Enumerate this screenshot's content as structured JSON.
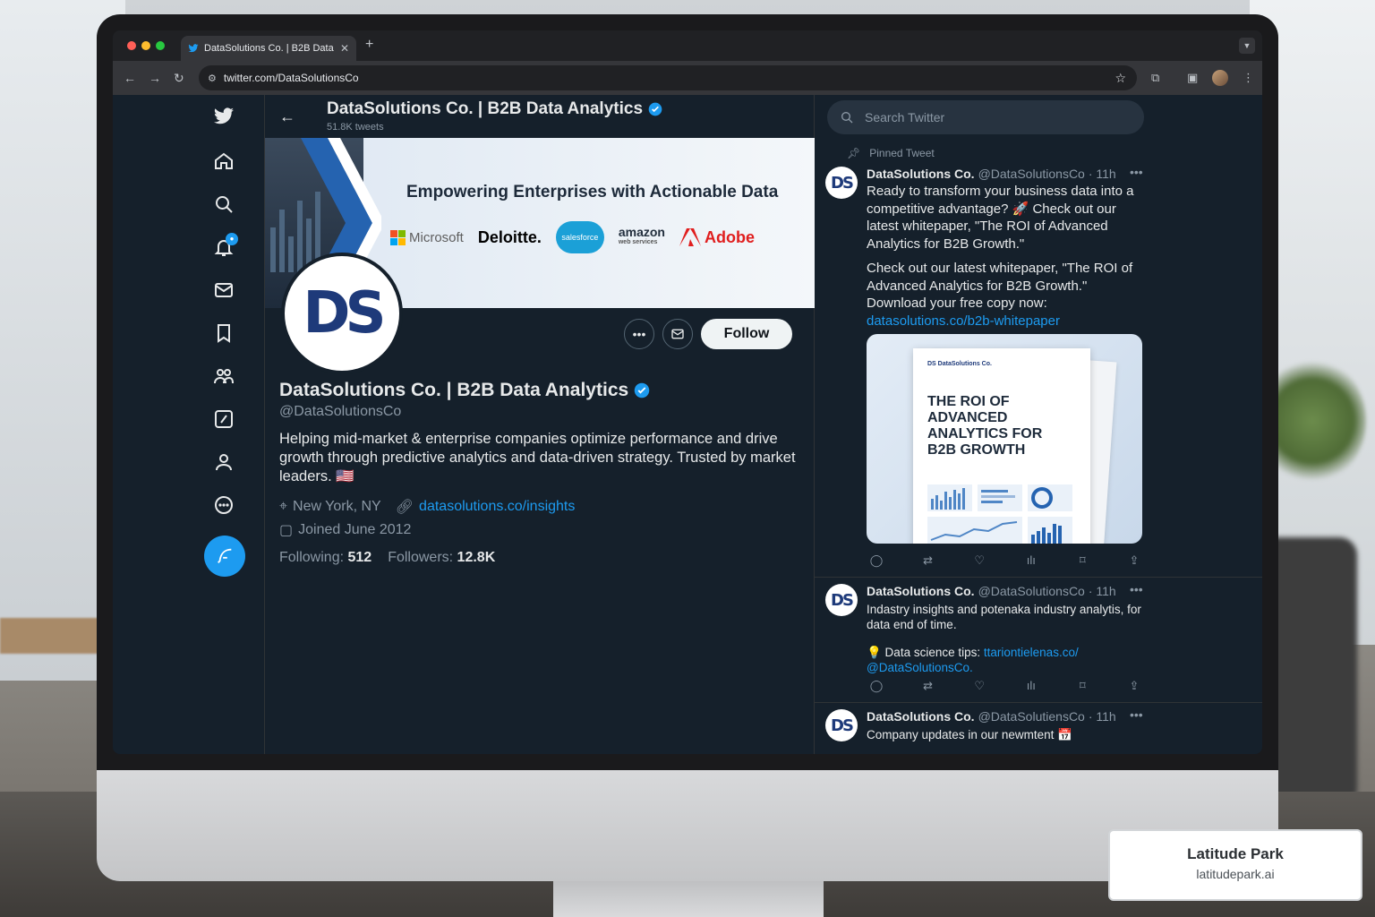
{
  "browser": {
    "tab_title": "DataSolutions Co. | B2B Data",
    "url": "twitter.com/DataSolutionsCo"
  },
  "profile": {
    "header_name": "DataSolutions Co. | B2B Data Analytics",
    "tweet_count": "51.8K tweets",
    "banner_title": "Empowering Enterprises with Actionable Data",
    "banner_logos": [
      "Microsoft",
      "Deloitte.",
      "salesforce",
      "amazon",
      "Adobe"
    ],
    "aws_sub": "web services",
    "avatar_text": "DS",
    "follow_label": "Follow",
    "name": "DataSolutions Co. | B2B Data Analytics",
    "handle": "@DataSolutionsCo",
    "bio": "Helping mid-market & enterprise companies optimize performance and drive growth through predictive analytics and data-driven strategy. Trusted by market leaders. 🇺🇸",
    "location": "New York, NY",
    "website": "datasolutions.co/insights",
    "joined": "Joined June 2012",
    "following_label": "Following:",
    "following_count": "512",
    "followers_label": "Followers:",
    "followers_count": "12.8K"
  },
  "search": {
    "placeholder": "Search Twitter"
  },
  "tweets": [
    {
      "pinned_label": "Pinned Tweet",
      "name": "DataSolutions Co.",
      "handle": "@DataSolutionsCo",
      "time": "· 11h",
      "text_1": "Ready to transform your business data into a competitive advantage? 🚀 Check out our latest whitepaper, \"The ROI of Advanced Analytics for B2B Growth.\"",
      "text_2": "Check out our latest whitepaper, \"The ROI of Advanced Analytics for B2B Growth.\" Download your free copy now:",
      "link": "datasolutions.co/b2b-whitepaper",
      "media_logo": "DS DataSolutions Co.",
      "media_title": "THE ROI OF\nADVANCED\nANALYTICS FOR\nB2B GROWTH"
    },
    {
      "name": "DataSolutions Co.",
      "handle": "@DataSolutionsCo",
      "time": "· 11h",
      "text_1": "Indastry insights and potenaka industry analytis, for data end of time.",
      "tip_label": "💡 Data science tips:",
      "tip_link": "ttariontielenas.co/",
      "tip_handle": "@DataSolutionsCo."
    },
    {
      "name": "DataSolutions Co.",
      "handle": "@DataSolutiensCo",
      "time": "· 11h",
      "text_1": "Company updates in our newmtent 📅"
    }
  ],
  "watermark": {
    "title": "Latitude Park",
    "subtitle": "latitudepark.ai"
  },
  "colors": {
    "twitter_blue": "#1d9bf0",
    "bg_dark": "#15202b",
    "text_primary": "#e7e9ea",
    "text_secondary": "#8b98a5"
  }
}
